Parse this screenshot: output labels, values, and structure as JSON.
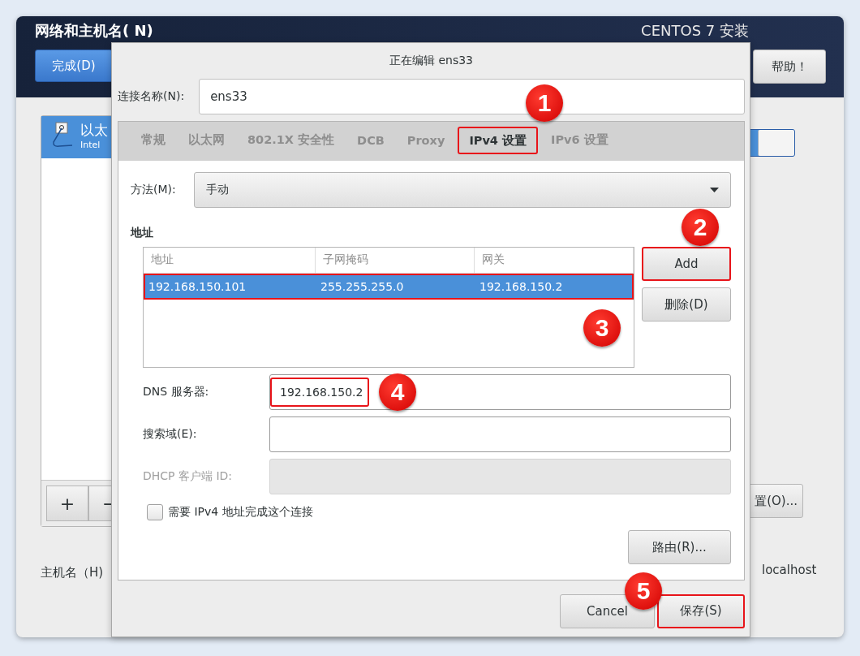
{
  "installer": {
    "title": "网络和主机名( N)",
    "product": "CENTOS 7 安装",
    "done_button": "完成(D)",
    "help_button": "帮助！",
    "connections": [
      {
        "name": "以太",
        "detail": "Intel",
        "selected": true
      }
    ],
    "add_button": "+",
    "remove_button": "−",
    "switch": {
      "on": true
    },
    "configure_button": "置(O)...",
    "hostname_label": "主机名（H)",
    "hostname_value": "localhost"
  },
  "dialog": {
    "title": "正在编辑 ens33",
    "connection_name_label": "连接名称(N):",
    "connection_name": "ens33",
    "tabs": [
      {
        "label": "常规",
        "selected": false,
        "highlighted": false
      },
      {
        "label": "以太网",
        "selected": false,
        "highlighted": false
      },
      {
        "label": "802.1X 安全性",
        "selected": false,
        "highlighted": false
      },
      {
        "label": "DCB",
        "selected": false,
        "highlighted": false
      },
      {
        "label": "Proxy",
        "selected": false,
        "highlighted": false
      },
      {
        "label": "IPv4 设置",
        "selected": true,
        "highlighted": true
      },
      {
        "label": "IPv6 设置",
        "selected": false,
        "highlighted": false
      }
    ],
    "method_label": "方法(M):",
    "method_value": "手动",
    "addresses_heading": "地址",
    "columns": [
      "地址",
      "子网掩码",
      "网关"
    ],
    "rows": [
      {
        "cells": [
          "192.168.150.101",
          "255.255.255.0",
          "192.168.150.2"
        ],
        "selected": true,
        "highlighted": true
      }
    ],
    "side_buttons": [
      {
        "label": "Add",
        "highlighted": true
      },
      {
        "label": "删除(D)",
        "highlighted": false
      }
    ],
    "fields": [
      {
        "label": "DNS 服务器:",
        "value": "192.168.150.2",
        "disabled": false,
        "highlighted": true
      },
      {
        "label": "搜索域(E):",
        "disabled": false
      },
      {
        "label": "DHCP 客户端 ID:",
        "disabled": true
      }
    ],
    "checkbox": {
      "label": "需要 IPv4 地址完成这个连接",
      "checked": false
    },
    "routes_button": "路由(R)...",
    "footer_buttons": [
      {
        "label": "Cancel",
        "highlighted": false
      },
      {
        "label": "保存(S)",
        "highlighted": true
      }
    ]
  },
  "annotations": [
    {
      "number": "1"
    },
    {
      "number": "2"
    },
    {
      "number": "3"
    },
    {
      "number": "4"
    },
    {
      "number": "5"
    }
  ]
}
